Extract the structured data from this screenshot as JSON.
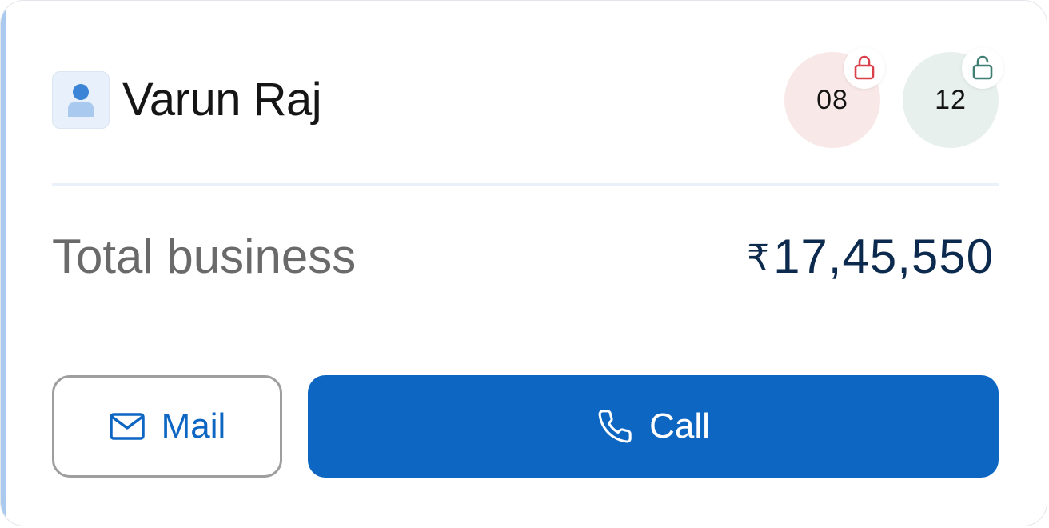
{
  "user": {
    "name": "Varun Raj"
  },
  "counts": {
    "locked": "08",
    "unlocked": "12"
  },
  "business": {
    "label": "Total business",
    "currency": "₹",
    "amount": "17,45,550"
  },
  "actions": {
    "mail_label": "Mail",
    "call_label": "Call"
  },
  "icons": {
    "avatar": "user-avatar-icon",
    "locked": "lock-closed-icon",
    "unlocked": "lock-open-icon",
    "mail": "envelope-icon",
    "call": "phone-icon"
  },
  "colors": {
    "accent": "#0d66c2",
    "locked": "#d9404a",
    "unlocked": "#3f7f73",
    "amount": "#0c2a4d"
  }
}
